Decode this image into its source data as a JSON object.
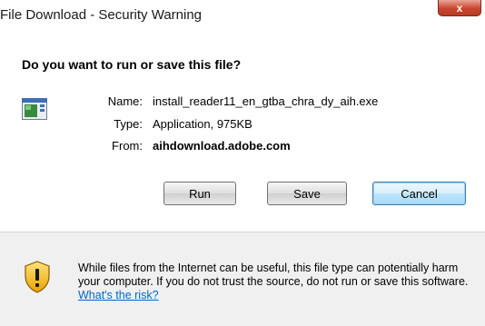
{
  "window": {
    "title": "File Download - Security Warning",
    "close_glyph": "x"
  },
  "dialog": {
    "heading": "Do you want to run or save this file?",
    "file_icon": "application-file-icon",
    "fields": {
      "name_label": "Name:",
      "name_value": "install_reader11_en_gtba_chra_dy_aih.exe",
      "type_label": "Type:",
      "type_value": "Application, 975KB",
      "from_label": "From:",
      "from_value": "aihdownload.adobe.com"
    },
    "buttons": {
      "run": "Run",
      "save": "Save",
      "cancel": "Cancel"
    }
  },
  "warning": {
    "icon": "shield-warning-icon",
    "text": "While files from the Internet can be useful, this file type can potentially harm your computer. If you do not trust the source, do not run or save this software.",
    "link": "What's the risk?"
  },
  "colors": {
    "link": "#0066cc",
    "close_button": "#c9462e",
    "warning_background": "#f0f0f0"
  }
}
